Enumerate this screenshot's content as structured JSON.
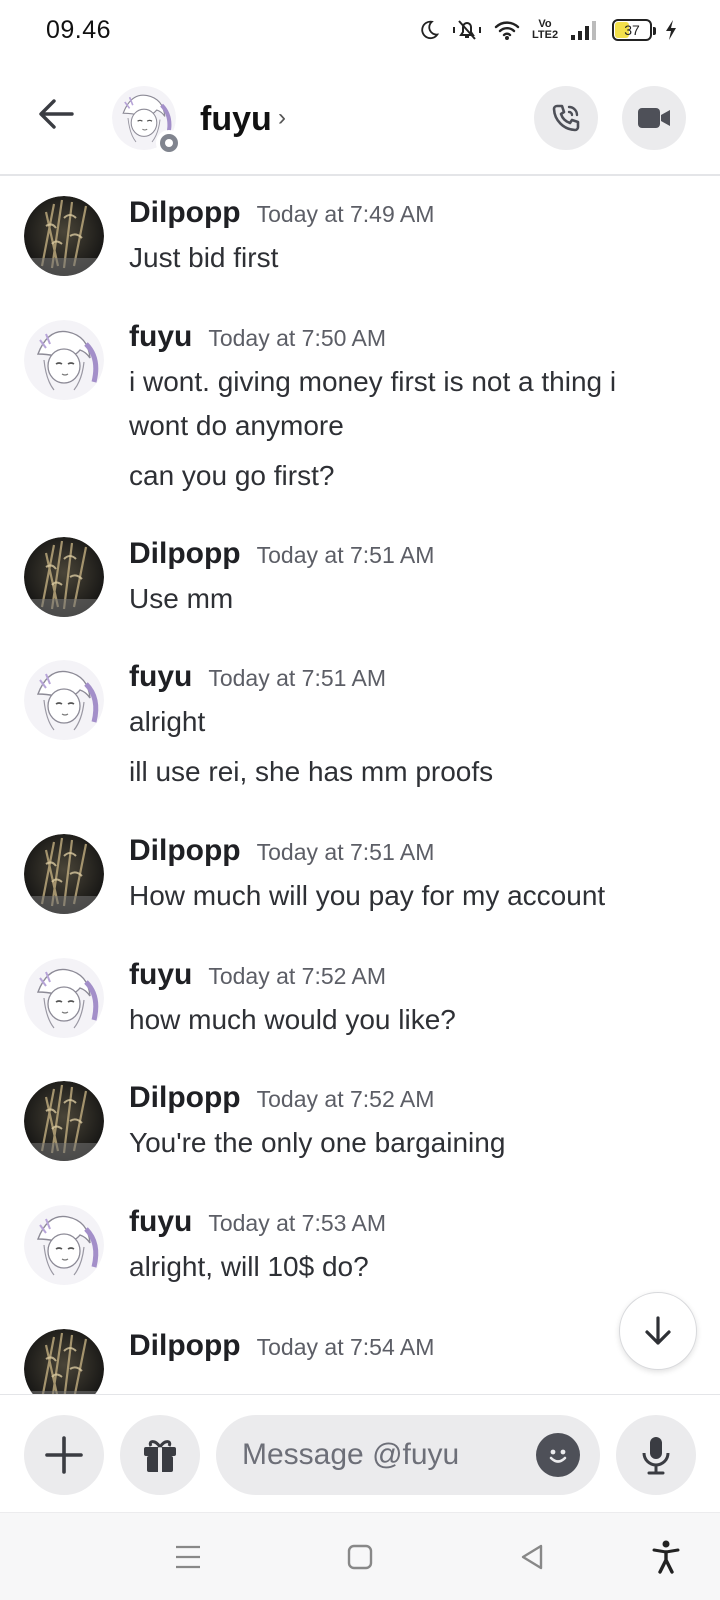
{
  "status_bar": {
    "time": "09.46",
    "network_label": "Vo LTE2",
    "battery": "37"
  },
  "header": {
    "name": "fuyu",
    "chevron": "›",
    "status": "offline"
  },
  "messages": [
    {
      "author": "Dilpopp",
      "time": "Today at 7:49 AM",
      "lines": [
        "Just bid first"
      ]
    },
    {
      "author": "fuyu",
      "time": "Today at 7:50 AM",
      "lines": [
        "i wont. giving money first is not a thing i",
        "wont do anymore",
        "can you go first?"
      ]
    },
    {
      "author": "Dilpopp",
      "time": "Today at 7:51 AM",
      "lines": [
        "Use mm"
      ]
    },
    {
      "author": "fuyu",
      "time": "Today at 7:51 AM",
      "lines": [
        "alright",
        "ill use rei, she has mm proofs"
      ]
    },
    {
      "author": "Dilpopp",
      "time": "Today at 7:51 AM",
      "lines": [
        "How much will you pay for my account"
      ]
    },
    {
      "author": "fuyu",
      "time": "Today at 7:52 AM",
      "lines": [
        "how much would you like?"
      ]
    },
    {
      "author": "Dilpopp",
      "time": "Today at 7:52 AM",
      "lines": [
        "You're the only one bargaining"
      ]
    },
    {
      "author": "fuyu",
      "time": "Today at 7:53 AM",
      "lines": [
        "alright, will 10$ do?"
      ]
    },
    {
      "author": "Dilpopp",
      "time": "Today at 7:54 AM",
      "lines": []
    }
  ],
  "composer": {
    "placeholder": "Message @fuyu"
  },
  "colors": {
    "button_bg": "#ebebed",
    "timestamp": "#5c5e66",
    "offline_status": "#80848e"
  },
  "icons": [
    "back-arrow-icon",
    "phone-call-icon",
    "video-camera-icon",
    "arrow-down-icon",
    "plus-icon",
    "gift-icon",
    "emoji-icon",
    "microphone-icon",
    "menu-icon",
    "home-square-icon",
    "back-triangle-icon",
    "accessibility-icon"
  ]
}
